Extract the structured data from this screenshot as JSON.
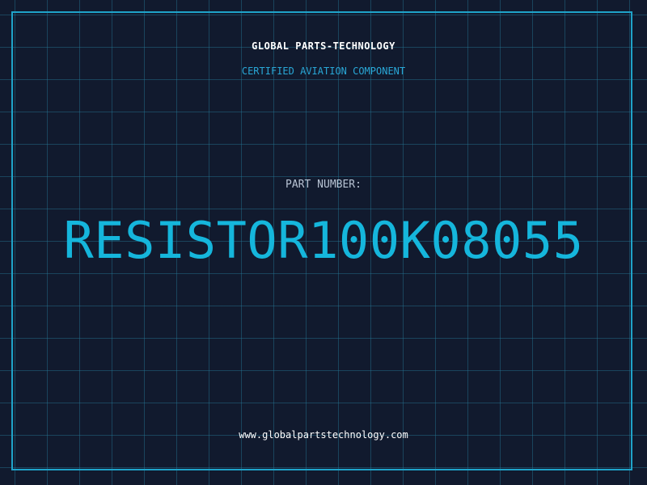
{
  "header": {
    "brand": "GLOBAL PARTS-TECHNOLOGY",
    "subtitle": "CERTIFIED AVIATION COMPONENT"
  },
  "main": {
    "part_label": "PART NUMBER:",
    "part_number": "RESISTOR100K08055"
  },
  "footer": {
    "website": "www.globalpartstechnology.com"
  },
  "colors": {
    "background": "#111a2e",
    "grid": "#257896",
    "frame": "#1fa3c9",
    "accent": "#15b6dc",
    "text_primary": "#ffffff",
    "text_muted": "#b8c4d4"
  }
}
